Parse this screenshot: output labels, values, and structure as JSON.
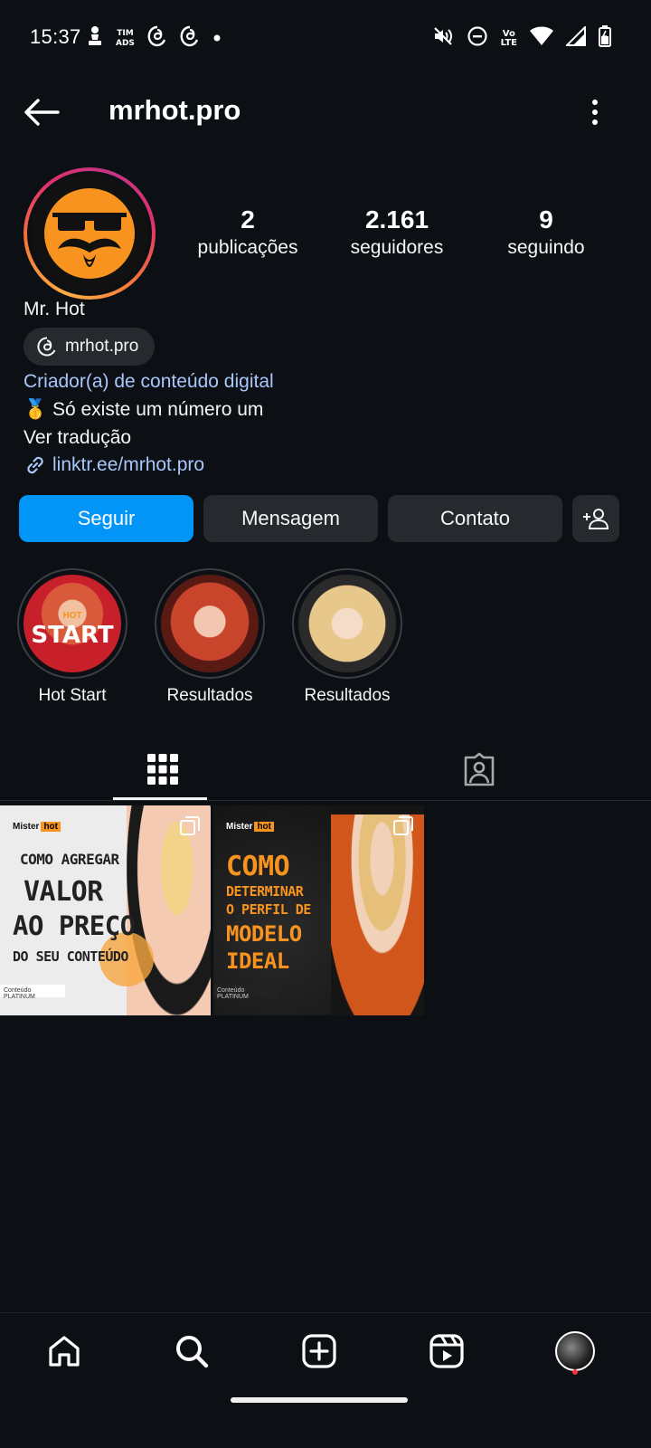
{
  "status_bar": {
    "time": "15:37",
    "carrier_label_top": "TIM",
    "carrier_label_bottom": "ADS",
    "volte_top": "Vo",
    "volte_bottom": "LTE",
    "left_icons": [
      "chess-pawn-icon",
      "carrier-ads-icon",
      "threads-icon",
      "threads-icon",
      "dot-icon"
    ],
    "right_icons": [
      "mute-icon",
      "do-not-disturb-icon",
      "volte-icon",
      "wifi-icon",
      "signal-icon",
      "battery-charging-icon"
    ]
  },
  "top_bar": {
    "username": "mrhot.pro"
  },
  "profile": {
    "stats": [
      {
        "value": "2",
        "label": "publicações"
      },
      {
        "value": "2.161",
        "label": "seguidores"
      },
      {
        "value": "9",
        "label": "seguindo"
      }
    ],
    "display_name": "Mr. Hot",
    "threads_handle": "mrhot.pro",
    "category": "Criador(a) de conteúdo digital",
    "bio": "🥇 Só existe um número um",
    "see_translation": "Ver tradução",
    "link": "linktr.ee/mrhot.pro"
  },
  "actions": {
    "follow": "Seguir",
    "message": "Mensagem",
    "contact": "Contato"
  },
  "highlights": [
    {
      "label": "Hot Start",
      "overlay": "START",
      "overlay_small": "HOT"
    },
    {
      "label": "Resultados"
    },
    {
      "label": "Resultados"
    }
  ],
  "tabs": [
    "grid-icon",
    "tagged-icon"
  ],
  "posts": [
    {
      "brand": "Mister",
      "brand_tag": "hot",
      "lines": [
        "COMO AGREGAR",
        "VALOR",
        "AO PREÇO",
        "DO SEU CONTEÚDO"
      ],
      "footer": "Conteúdo PLATINUM"
    },
    {
      "brand": "Mister",
      "brand_tag": "hot",
      "lines": [
        "COMO",
        "DETERMINAR",
        "O PERFIL DE",
        "MODELO",
        "IDEAL"
      ],
      "footer": "Conteúdo PLATINUM"
    }
  ],
  "bottom_nav": [
    "home-icon",
    "search-icon",
    "create-icon",
    "reels-icon",
    "profile-avatar"
  ],
  "colors": {
    "background": "#0c1014",
    "follow_button": "#0095f6",
    "secondary_button": "#262a2e",
    "link": "#a8c7fa",
    "accent_orange": "#f7931e"
  }
}
